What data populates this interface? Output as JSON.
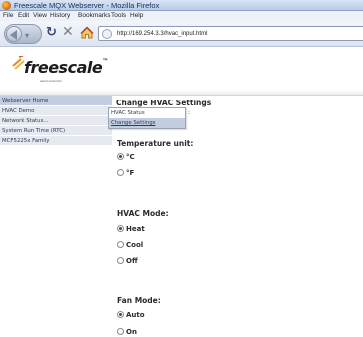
{
  "window": {
    "title": "Freescale MQX Webserver - Mozilla Firefox"
  },
  "menu": [
    "File",
    "Edit",
    "View",
    "History",
    "Bookmarks",
    "Tools",
    "Help"
  ],
  "address_bar": {
    "url": "http://169.254.3.3/hvac_input.html"
  },
  "logo": {
    "word": "freescale",
    "tm": "™",
    "tagline": "semiconductor"
  },
  "sidebar": {
    "items": [
      {
        "label": "Webserver Home",
        "active": true
      },
      {
        "label": "HVAC Demo",
        "active": false
      },
      {
        "label": "Network Status...",
        "active": false
      },
      {
        "label": "System Run Time (RTC)",
        "active": false
      },
      {
        "label": "MCF5225x Family",
        "active": false
      }
    ]
  },
  "main": {
    "title": "Change HVAC Settings",
    "popup": {
      "items": [
        "HVAC Status",
        "Change Settings"
      ],
      "suffix": ":"
    },
    "temperature": {
      "label": "Temperature unit:",
      "options": [
        "°C",
        "°F"
      ],
      "selected": 0
    },
    "hvac_mode": {
      "label": "HVAC Mode:",
      "options": [
        "Heat",
        "Cool",
        "Off"
      ],
      "selected": 0
    },
    "fan_mode": {
      "label": "Fan Mode:",
      "options": [
        "Auto",
        "On"
      ],
      "selected": 0
    }
  }
}
